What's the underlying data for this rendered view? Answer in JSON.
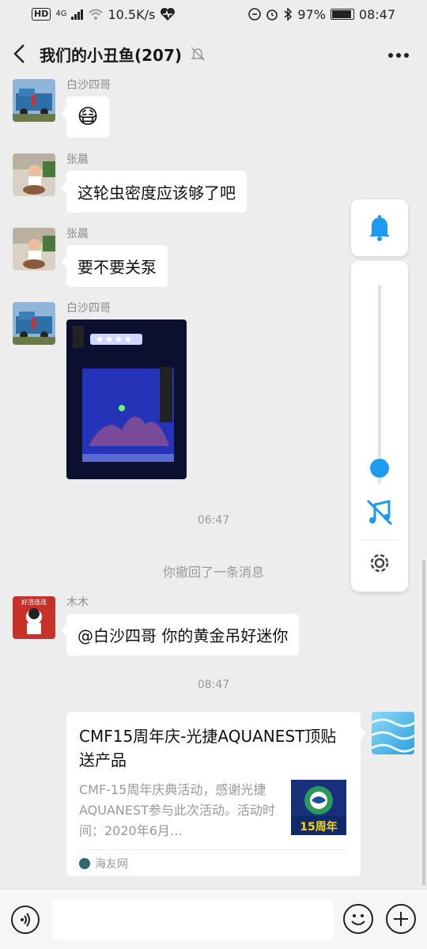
{
  "status_bar": {
    "hd": "HD",
    "net_type": "4G",
    "speed": "10.5K/s",
    "battery_pct": "97%",
    "battery_level": 0.97,
    "time": "08:47"
  },
  "header": {
    "title": "我们的小丑鱼(207)",
    "back_icon": "chevron-left-icon",
    "mute_icon": "bell-off-icon",
    "more_icon": "more-dots-icon"
  },
  "messages": [
    {
      "sender": "白沙四哥",
      "emoji": "😷"
    },
    {
      "sender": "张晨",
      "text": "这轮虫密度应该够了吧"
    },
    {
      "sender": "张晨",
      "text": "要不要关泵"
    },
    {
      "sender": "白沙四哥",
      "image": "aquarium-photo"
    },
    {
      "sender": "木木",
      "text": "@白沙四哥  你的黄金吊好迷你"
    }
  ],
  "timestamps": [
    "06:47",
    "08:47"
  ],
  "system_notice": "你撤回了一条消息",
  "avatar_text": "好活连连",
  "link_card": {
    "title": "CMF15周年庆-光捷AQUANEST顶贴送产品",
    "description": "CMF-15周年庆典活动，感谢光捷AQUANEST参与此次活动。活动时间：2020年6月…",
    "thumb_text": "15周年",
    "source": "海友网"
  },
  "floating_widget": {
    "volume_level": 0.08,
    "bell_icon": "bell-icon",
    "music_icon": "music-off-icon",
    "settings_icon": "gear-icon"
  },
  "colors": {
    "accent": "#1e9bf0",
    "background": "#ededed"
  },
  "input_bar": {
    "placeholder": ""
  }
}
